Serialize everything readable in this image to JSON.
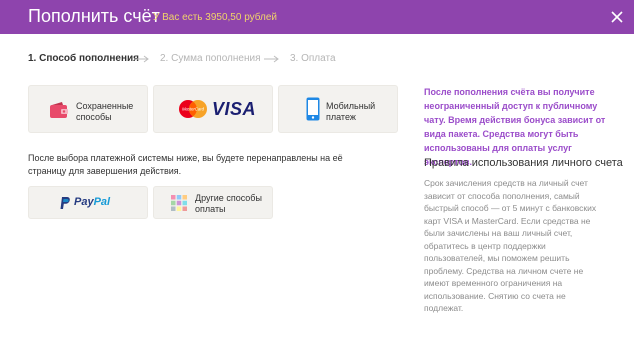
{
  "header": {
    "title": "Пополнить счёт",
    "balance": "У Вас есть 3950,50 рублей",
    "accent_color": "#8e44ad",
    "balance_color": "#f1d36b",
    "close_icon": "close-icon"
  },
  "steps": [
    {
      "label": "1. Способ пополнения",
      "active": true
    },
    {
      "label": "2. Сумма пополнения",
      "active": false
    },
    {
      "label": "3. Оплата",
      "active": false
    }
  ],
  "methods": {
    "saved": {
      "label_line1": "Сохраненные",
      "label_line2": "способы",
      "icon": "wallet-icon"
    },
    "cards": {
      "mastercard_text": "MasterCard",
      "visa_text": "VISA",
      "icon": "mastercard-visa-logo"
    },
    "mobile": {
      "label_line1": "Мобильный",
      "label_line2": "платеж",
      "icon": "mobile-phone-icon"
    },
    "paypal": {
      "text_dark": "Pay",
      "text_light": "Pal",
      "icon": "paypal-logo"
    },
    "other": {
      "label_line1": "Другие способы",
      "label_line2": "оплаты",
      "icon": "grid-icon"
    }
  },
  "redirect_note": "После выбора платежной системы ниже, вы будете перенаправлены на её страницу для завершения действия.",
  "sidebar": {
    "promo": "После пополнения счёта вы получите неограниченный доступ к публичному чату. Время действия бонуса зависит от вида пакета. Средства могут быть использованы для оплаты услуг экспертов.",
    "rules_title": "Правила использования личного счета",
    "rules_text": "Срок зачисления средств на личный счет зависит от способа пополнения, самый быстрый способ — от 5 минут с банковских карт VISA и MasterCard. Если средства не были зачислены на ваш личный счет, обратитесь в центр поддержки пользователей, мы поможем решить проблему. Средства на личном счете не имеют временного ограничения на использование. Снятию со счета не подлежат."
  }
}
